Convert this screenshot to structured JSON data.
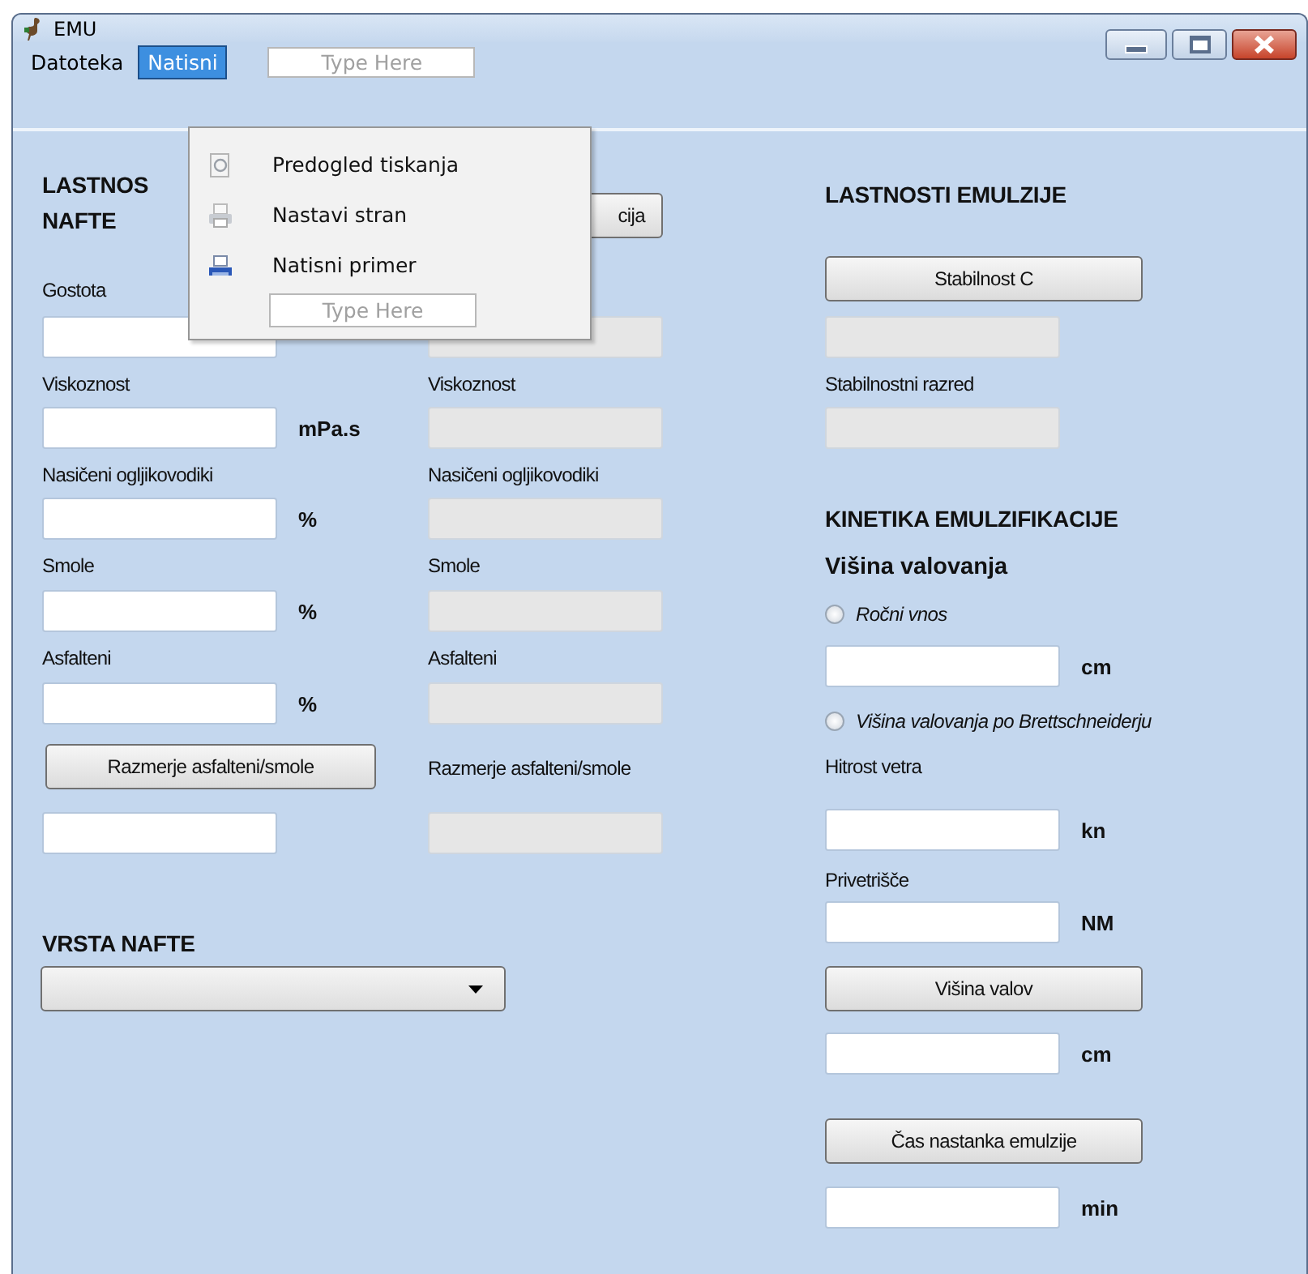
{
  "window": {
    "title": "EMU"
  },
  "menu_bar": {
    "items": [
      {
        "label": "Datoteka",
        "selected": false
      },
      {
        "label": "Natisni",
        "selected": true
      }
    ],
    "placeholder": "Type Here"
  },
  "open_menu": {
    "items": [
      {
        "label": "Predogled tiskanja",
        "kind": "preview"
      },
      {
        "label": "Nastavi stran",
        "kind": "page_setup"
      },
      {
        "label": "Natisni primer",
        "kind": "print"
      }
    ],
    "placeholder": "Type Here"
  },
  "columns": [
    {
      "items": [
        {
          "kind": "heading",
          "lines": [
            "LASTNOS",
            "NAFTE"
          ]
        },
        {
          "kind": "label",
          "text": "Gostota"
        },
        {
          "kind": "field",
          "disabled": false
        },
        {
          "kind": "label",
          "text": "Viskoznost"
        },
        {
          "kind": "field",
          "unit": "mPa.s",
          "disabled": false
        },
        {
          "kind": "label",
          "text": "Nasičeni ogljikovodiki"
        },
        {
          "kind": "field",
          "unit": "%",
          "disabled": false
        },
        {
          "kind": "label",
          "text": "Smole"
        },
        {
          "kind": "field",
          "unit": "%",
          "disabled": false
        },
        {
          "kind": "label",
          "text": "Asfalteni"
        },
        {
          "kind": "field",
          "unit": "%",
          "disabled": false
        },
        {
          "kind": "button",
          "text": "Razmerje asfalteni/smole"
        },
        {
          "kind": "field",
          "disabled": false
        },
        {
          "kind": "heading",
          "lines": [
            "VRSTA NAFTE"
          ]
        },
        {
          "kind": "combo"
        }
      ]
    },
    {
      "items": [
        {
          "kind": "button",
          "text": "cija"
        },
        {
          "kind": "field",
          "disabled": true
        },
        {
          "kind": "label",
          "text": "Viskoznost"
        },
        {
          "kind": "field",
          "disabled": true
        },
        {
          "kind": "label",
          "text": "Nasičeni ogljikovodiki"
        },
        {
          "kind": "field",
          "disabled": true
        },
        {
          "kind": "label",
          "text": "Smole"
        },
        {
          "kind": "field",
          "disabled": true
        },
        {
          "kind": "label",
          "text": "Asfalteni"
        },
        {
          "kind": "field",
          "disabled": true
        },
        {
          "kind": "label",
          "text": "Razmerje asfalteni/smole"
        },
        {
          "kind": "field",
          "disabled": true
        }
      ]
    },
    {
      "items": [
        {
          "kind": "heading",
          "lines": [
            "LASTNOSTI EMULZIJE"
          ]
        },
        {
          "kind": "button",
          "text": "Stabilnost C"
        },
        {
          "kind": "field",
          "disabled": true
        },
        {
          "kind": "label",
          "text": "Stabilnostni razred"
        },
        {
          "kind": "field",
          "disabled": true
        },
        {
          "kind": "heading",
          "lines": [
            "KINETIKA EMULZIFIKACIJE"
          ]
        },
        {
          "kind": "subheading",
          "text": "Višina valovanja"
        },
        {
          "kind": "radio",
          "text": "Ročni vnos",
          "selected": false
        },
        {
          "kind": "field",
          "unit": "cm",
          "disabled": false
        },
        {
          "kind": "radio",
          "text": "Višina valovanja po Brettschneiderju",
          "selected": false
        },
        {
          "kind": "label",
          "text": "Hitrost vetra"
        },
        {
          "kind": "field",
          "unit": "kn",
          "disabled": false
        },
        {
          "kind": "label",
          "text": "Privetrišče"
        },
        {
          "kind": "field",
          "unit": "NM",
          "disabled": false
        },
        {
          "kind": "button",
          "text": "Višina valov"
        },
        {
          "kind": "field",
          "unit": "cm",
          "disabled": false
        },
        {
          "kind": "button",
          "text": "Čas nastanka emulzije"
        },
        {
          "kind": "field",
          "unit": "min",
          "disabled": false
        }
      ]
    }
  ]
}
